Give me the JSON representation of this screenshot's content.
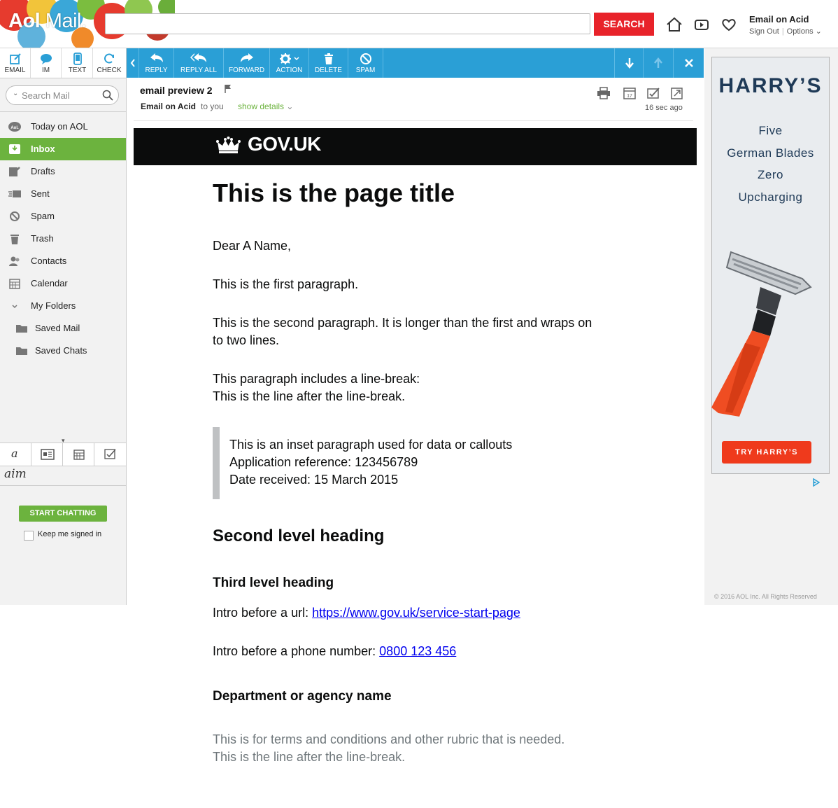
{
  "app": {
    "logo_prefix": "Aol",
    "logo_suffix": "Mail.",
    "search_button": "SEARCH",
    "user_name": "Email on Acid",
    "sign_out": "Sign Out",
    "options": "Options"
  },
  "compose_toolbar": [
    {
      "label": "EMAIL",
      "icon": "compose-icon"
    },
    {
      "label": "IM",
      "icon": "chat-bubble-icon"
    },
    {
      "label": "TEXT",
      "icon": "phone-icon"
    },
    {
      "label": "CHECK",
      "icon": "refresh-icon"
    }
  ],
  "message_toolbar": {
    "reply": "REPLY",
    "reply_all": "REPLY ALL",
    "forward": "FORWARD",
    "action": "ACTION",
    "delete": "DELETE",
    "spam": "SPAM"
  },
  "sidebar": {
    "search_placeholder": "Search Mail",
    "items": [
      {
        "label": "Today on AOL",
        "icon": "aol-icon"
      },
      {
        "label": "Inbox",
        "icon": "inbox-icon",
        "active": true
      },
      {
        "label": "Drafts",
        "icon": "drafts-icon"
      },
      {
        "label": "Sent",
        "icon": "sent-icon"
      },
      {
        "label": "Spam",
        "icon": "spam-icon"
      },
      {
        "label": "Trash",
        "icon": "trash-icon"
      },
      {
        "label": "Contacts",
        "icon": "contacts-icon"
      },
      {
        "label": "Calendar",
        "icon": "calendar-icon"
      },
      {
        "label": "My Folders",
        "icon": "chevron-down-icon"
      },
      {
        "label": "Saved Mail",
        "icon": "folder-icon"
      },
      {
        "label": "Saved Chats",
        "icon": "folder-icon"
      }
    ],
    "aim_label": "aim",
    "start_chatting": "START CHATTING",
    "keep_signed_in": "Keep me signed in"
  },
  "message": {
    "subject": "email preview 2",
    "from": "Email on Acid",
    "to": "to you",
    "show_details": "show details",
    "time": "16 sec ago"
  },
  "email": {
    "brand": "GOV.UK",
    "title": "This is the page title",
    "greeting": "Dear A Name,",
    "para1": "This is the first paragraph.",
    "para2_line1": "This is the second paragraph. It is longer than the first and wraps on",
    "para2_line2": "to two lines.",
    "para3_line1": "This paragraph includes a line-break:",
    "para3_line2": "This is the line after the line-break.",
    "inset_line1": "This is an inset paragraph used for data or callouts",
    "inset_line2": "Application reference: 123456789",
    "inset_line3": "Date received: 15 March 2015",
    "heading2": "Second level heading",
    "heading3": "Third level heading",
    "url_intro": "Intro before a url: ",
    "url": "https://www.gov.uk/service-start-page",
    "phone_intro": "Intro before a phone number: ",
    "phone": "0800 123 456",
    "department": "Department or agency name",
    "rubric_line1": "This is for terms and conditions and other rubric that is needed.",
    "rubric_line2": "This is the line after the line-break."
  },
  "ad": {
    "brand": "HARRY’S",
    "lines": [
      "Five",
      "German Blades",
      "Zero",
      "Upcharging"
    ],
    "cta": "TRY HARRY’S",
    "copyright": "© 2016 AOL Inc. All Rights Reserved"
  },
  "colors": {
    "toolbar_blue": "#2a9fd6",
    "active_green": "#6cb33e",
    "search_red": "#e8232a",
    "gov_black": "#0b0c0c",
    "ad_cta": "#ef3a1c"
  }
}
